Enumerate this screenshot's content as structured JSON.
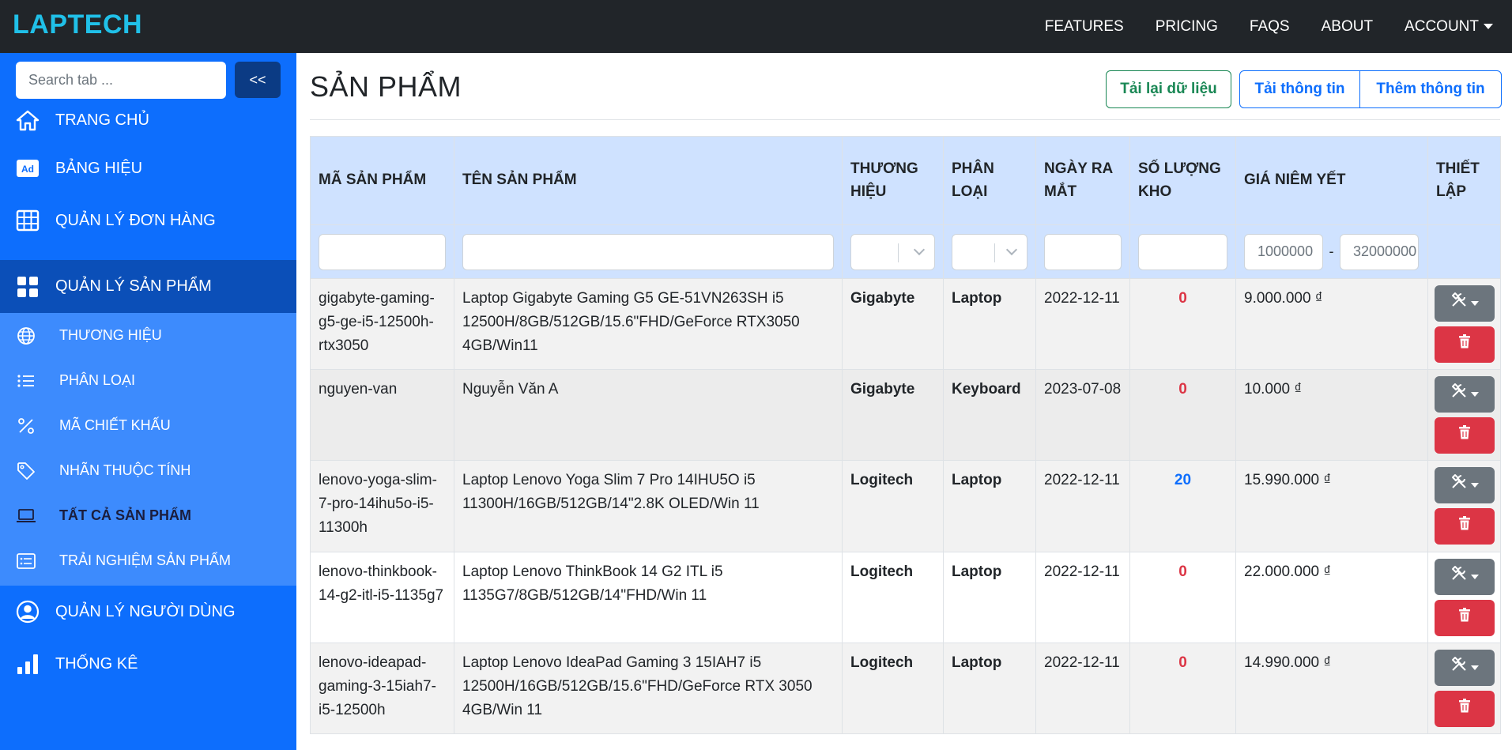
{
  "navbar": {
    "brand": "LAPTECH",
    "links": [
      "FEATURES",
      "PRICING",
      "FAQS",
      "ABOUT"
    ],
    "account": "ACCOUNT"
  },
  "sidebar": {
    "search_placeholder": "Search tab ...",
    "collapse_label": "<<",
    "items": [
      {
        "label": "TRANG CHỦ",
        "icon": "home-icon"
      },
      {
        "label": "BẢNG HIỆU",
        "icon": "ad-icon"
      },
      {
        "label": "QUẢN LÝ ĐƠN HÀNG",
        "icon": "table-icon"
      },
      {
        "label": "QUẢN LÝ SẢN PHẨM",
        "icon": "grid-icon"
      },
      {
        "label": "QUẢN LÝ NGƯỜI DÙNG",
        "icon": "user-circle-icon"
      },
      {
        "label": "THỐNG KÊ",
        "icon": "bar-chart-icon"
      }
    ],
    "subitems": [
      {
        "label": "THƯƠNG HIỆU",
        "icon": "globe-icon"
      },
      {
        "label": "PHÂN LOẠI",
        "icon": "list-icon"
      },
      {
        "label": "MÃ CHIẾT KHẤU",
        "icon": "percent-icon"
      },
      {
        "label": "NHÃN THUỘC TÍNH",
        "icon": "tag-icon"
      },
      {
        "label": "TẤT CẢ SẢN PHẨM",
        "icon": "laptop-icon"
      },
      {
        "label": "TRẢI NGHIỆM SẢN PHẨM",
        "icon": "card-list-icon"
      }
    ]
  },
  "main": {
    "title": "SẢN PHẨM",
    "reload_label": "Tải lại dữ liệu",
    "download_label": "Tải thông tin",
    "add_label": "Thêm thông tin",
    "table": {
      "headers": [
        "MÃ SẢN PHẨM",
        "TÊN SẢN PHẨM",
        "THƯƠNG HIỆU",
        "PHÂN LOẠI",
        "NGÀY RA MẮT",
        "SỐ LƯỢNG KHO",
        "GIÁ NIÊM YẾT",
        "THIẾT LẬP"
      ],
      "price_min_placeholder": "1000000",
      "price_max_placeholder": "32000000",
      "price_dash": "-",
      "rows": [
        {
          "id": "gigabyte-gaming-g5-ge-i5-12500h-rtx3050",
          "name": "Laptop Gigabyte Gaming G5 GE-51VN263SH i5 12500H/8GB/512GB/15.6\"FHD/GeForce RTX3050 4GB/Win11",
          "brand": "Gigabyte",
          "category": "Laptop",
          "date": "2022-12-11",
          "qty": "0",
          "price": "9.000.000 ₫"
        },
        {
          "id": "nguyen-van",
          "name": "Nguyễn Văn A",
          "brand": "Gigabyte",
          "category": "Keyboard",
          "date": "2023-07-08",
          "qty": "0",
          "price": "10.000 ₫"
        },
        {
          "id": "lenovo-yoga-slim-7-pro-14ihu5o-i5-11300h",
          "name": "Laptop Lenovo Yoga Slim 7 Pro 14IHU5O i5 11300H/16GB/512GB/14\"2.8K OLED/Win 11",
          "brand": "Logitech",
          "category": "Laptop",
          "date": "2022-12-11",
          "qty": "20",
          "price": "15.990.000 ₫"
        },
        {
          "id": "lenovo-thinkbook-14-g2-itl-i5-1135g7",
          "name": "Laptop Lenovo ThinkBook 14 G2 ITL i5 1135G7/8GB/512GB/14\"FHD/Win 11",
          "brand": "Logitech",
          "category": "Laptop",
          "date": "2022-12-11",
          "qty": "0",
          "price": "22.000.000 ₫"
        },
        {
          "id": "lenovo-ideapad-gaming-3-15iah7-i5-12500h",
          "name": "Laptop Lenovo IdeaPad Gaming 3 15IAH7 i5 12500H/16GB/512GB/15.6\"FHD/GeForce RTX 3050 4GB/Win 11",
          "brand": "Logitech",
          "category": "Laptop",
          "date": "2022-12-11",
          "qty": "0",
          "price": "14.990.000 ₫"
        }
      ]
    }
  }
}
